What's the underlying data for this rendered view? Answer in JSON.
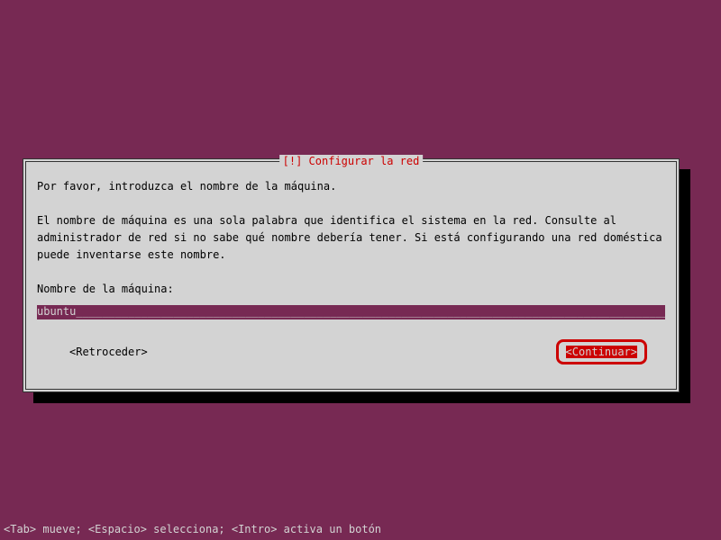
{
  "dialog": {
    "title": "[!] Configurar la red",
    "intro": "Por favor, introduzca el nombre de la máquina.",
    "description": "El nombre de máquina es una sola palabra que identifica el sistema en la red. Consulte al administrador de red si no sabe qué nombre debería tener. Si está configurando una red doméstica puede inventarse este nombre.",
    "label": "Nombre de la máquina:",
    "input_value": "ubuntu",
    "back_label": "<Retroceder>",
    "continue_label": "<Continuar>"
  },
  "status_bar": "<Tab> mueve; <Espacio> selecciona; <Intro> activa un botón",
  "colors": {
    "background": "#772953",
    "dialog_bg": "#d3d3d3",
    "accent": "#cc0000"
  }
}
